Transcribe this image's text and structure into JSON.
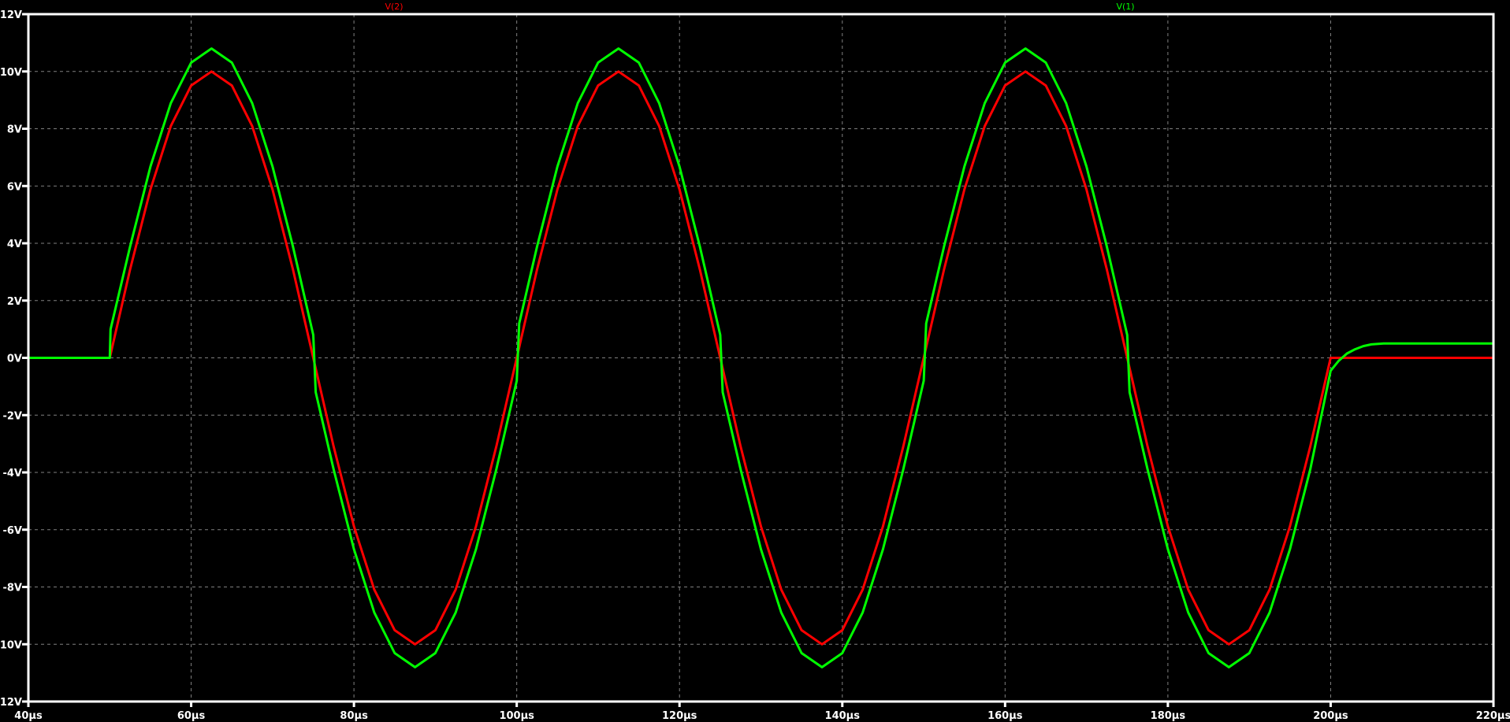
{
  "chart_data": {
    "type": "line",
    "title": "",
    "xlabel": "",
    "ylabel": "",
    "xlim": [
      40,
      220
    ],
    "ylim": [
      -12,
      12
    ],
    "x_unit": "µs",
    "y_unit": "V",
    "x_ticks": [
      "40µs",
      "60µs",
      "80µs",
      "100µs",
      "120µs",
      "140µs",
      "160µs",
      "180µs",
      "200µs",
      "220µs"
    ],
    "x_tick_values": [
      40,
      60,
      80,
      100,
      120,
      140,
      160,
      180,
      200,
      220
    ],
    "y_ticks": [
      "12V",
      "10V",
      "8V",
      "6V",
      "4V",
      "2V",
      "0V",
      "-2V",
      "-4V",
      "-6V",
      "-8V",
      "-10V",
      "-12V"
    ],
    "y_tick_values": [
      12,
      10,
      8,
      6,
      4,
      2,
      0,
      -2,
      -4,
      -6,
      -8,
      -10,
      -12
    ],
    "grid": true,
    "background": "#000000",
    "axis_color": "#ffffff",
    "grid_color": "#808080",
    "legend_placement": "top",
    "series": [
      {
        "name": "V(2)",
        "color": "#ff0000",
        "points": [
          [
            40,
            0
          ],
          [
            50,
            0
          ],
          [
            52.5,
            3.09
          ],
          [
            55,
            5.88
          ],
          [
            57.5,
            8.09
          ],
          [
            60,
            9.51
          ],
          [
            62.5,
            10
          ],
          [
            65,
            9.51
          ],
          [
            67.5,
            8.09
          ],
          [
            70,
            5.88
          ],
          [
            72.5,
            3.09
          ],
          [
            75,
            0
          ],
          [
            77.5,
            -3.09
          ],
          [
            80,
            -5.88
          ],
          [
            82.5,
            -8.09
          ],
          [
            85,
            -9.51
          ],
          [
            87.5,
            -10
          ],
          [
            90,
            -9.51
          ],
          [
            92.5,
            -8.09
          ],
          [
            95,
            -5.88
          ],
          [
            97.5,
            -3.09
          ],
          [
            100,
            0
          ],
          [
            102.5,
            3.09
          ],
          [
            105,
            5.88
          ],
          [
            107.5,
            8.09
          ],
          [
            110,
            9.51
          ],
          [
            112.5,
            10
          ],
          [
            115,
            9.51
          ],
          [
            117.5,
            8.09
          ],
          [
            120,
            5.88
          ],
          [
            122.5,
            3.09
          ],
          [
            125,
            0
          ],
          [
            127.5,
            -3.09
          ],
          [
            130,
            -5.88
          ],
          [
            132.5,
            -8.09
          ],
          [
            135,
            -9.51
          ],
          [
            137.5,
            -10
          ],
          [
            140,
            -9.51
          ],
          [
            142.5,
            -8.09
          ],
          [
            145,
            -5.88
          ],
          [
            147.5,
            -3.09
          ],
          [
            150,
            0
          ],
          [
            152.5,
            3.09
          ],
          [
            155,
            5.88
          ],
          [
            157.5,
            8.09
          ],
          [
            160,
            9.51
          ],
          [
            162.5,
            10
          ],
          [
            165,
            9.51
          ],
          [
            167.5,
            8.09
          ],
          [
            170,
            5.88
          ],
          [
            172.5,
            3.09
          ],
          [
            175,
            0
          ],
          [
            177.5,
            -3.09
          ],
          [
            180,
            -5.88
          ],
          [
            182.5,
            -8.09
          ],
          [
            185,
            -9.51
          ],
          [
            187.5,
            -10
          ],
          [
            190,
            -9.51
          ],
          [
            192.5,
            -8.09
          ],
          [
            195,
            -5.88
          ],
          [
            197.5,
            -3.09
          ],
          [
            200,
            0
          ],
          [
            220,
            0
          ]
        ]
      },
      {
        "name": "V(1)",
        "color": "#00ff00",
        "points": [
          [
            40,
            0
          ],
          [
            50,
            0
          ],
          [
            50.1,
            1.0
          ],
          [
            52.5,
            3.89
          ],
          [
            55,
            6.68
          ],
          [
            57.5,
            8.89
          ],
          [
            60,
            10.31
          ],
          [
            62.5,
            10.8
          ],
          [
            65,
            10.31
          ],
          [
            67.5,
            8.89
          ],
          [
            70,
            6.68
          ],
          [
            72.5,
            3.89
          ],
          [
            75,
            0.8
          ],
          [
            75.3,
            -1.2
          ],
          [
            77.5,
            -3.89
          ],
          [
            80,
            -6.68
          ],
          [
            82.5,
            -8.89
          ],
          [
            85,
            -10.31
          ],
          [
            87.5,
            -10.8
          ],
          [
            90,
            -10.31
          ],
          [
            92.5,
            -8.89
          ],
          [
            95,
            -6.68
          ],
          [
            97.5,
            -3.89
          ],
          [
            100,
            -0.8
          ],
          [
            100.3,
            1.2
          ],
          [
            102.5,
            3.89
          ],
          [
            105,
            6.68
          ],
          [
            107.5,
            8.89
          ],
          [
            110,
            10.31
          ],
          [
            112.5,
            10.8
          ],
          [
            115,
            10.31
          ],
          [
            117.5,
            8.89
          ],
          [
            120,
            6.68
          ],
          [
            122.5,
            3.89
          ],
          [
            125,
            0.8
          ],
          [
            125.3,
            -1.2
          ],
          [
            127.5,
            -3.89
          ],
          [
            130,
            -6.68
          ],
          [
            132.5,
            -8.89
          ],
          [
            135,
            -10.31
          ],
          [
            137.5,
            -10.8
          ],
          [
            140,
            -10.31
          ],
          [
            142.5,
            -8.89
          ],
          [
            145,
            -6.68
          ],
          [
            147.5,
            -3.89
          ],
          [
            150,
            -0.8
          ],
          [
            150.3,
            1.2
          ],
          [
            152.5,
            3.89
          ],
          [
            155,
            6.68
          ],
          [
            157.5,
            8.89
          ],
          [
            160,
            10.31
          ],
          [
            162.5,
            10.8
          ],
          [
            165,
            10.31
          ],
          [
            167.5,
            8.89
          ],
          [
            170,
            6.68
          ],
          [
            172.5,
            3.89
          ],
          [
            175,
            0.8
          ],
          [
            175.3,
            -1.2
          ],
          [
            177.5,
            -3.89
          ],
          [
            180,
            -6.68
          ],
          [
            182.5,
            -8.89
          ],
          [
            185,
            -10.31
          ],
          [
            187.5,
            -10.8
          ],
          [
            190,
            -10.31
          ],
          [
            192.5,
            -8.89
          ],
          [
            195,
            -6.68
          ],
          [
            197.5,
            -3.89
          ],
          [
            200,
            -0.45
          ],
          [
            201,
            -0.1
          ],
          [
            202,
            0.15
          ],
          [
            203,
            0.3
          ],
          [
            204,
            0.41
          ],
          [
            205,
            0.47
          ],
          [
            206.5,
            0.5
          ],
          [
            220,
            0.5
          ]
        ]
      }
    ]
  }
}
